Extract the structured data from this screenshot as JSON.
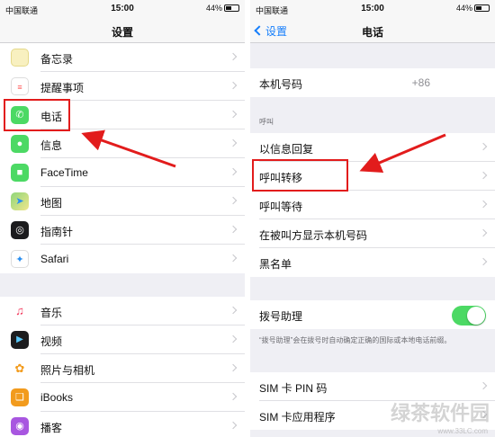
{
  "left": {
    "status": {
      "carrier": "中国联通",
      "time": "15:00",
      "battery": "44%"
    },
    "nav_title": "设置",
    "group1": [
      {
        "label": "备忘录",
        "icon": "notes-icon",
        "color": "#f8f0c0"
      },
      {
        "label": "提醒事项",
        "icon": "reminders-icon",
        "color": "#ffffff"
      },
      {
        "label": "电话",
        "icon": "phone-icon",
        "color": "#4cd964"
      },
      {
        "label": "信息",
        "icon": "messages-icon",
        "color": "#4cd964"
      },
      {
        "label": "FaceTime",
        "icon": "facetime-icon",
        "color": "#4cd964"
      },
      {
        "label": "地图",
        "icon": "maps-icon",
        "color": "#7ac36a"
      },
      {
        "label": "指南针",
        "icon": "compass-icon",
        "color": "#1c1c1e"
      },
      {
        "label": "Safari",
        "icon": "safari-icon",
        "color": "#2a8ef0"
      }
    ],
    "group2": [
      {
        "label": "音乐",
        "icon": "music-icon",
        "color": "#ffffff"
      },
      {
        "label": "视频",
        "icon": "videos-icon",
        "color": "#1c1c1e"
      },
      {
        "label": "照片与相机",
        "icon": "photos-icon",
        "color": "#ffffff"
      },
      {
        "label": "iBooks",
        "icon": "ibooks-icon",
        "color": "#f29b1d"
      },
      {
        "label": "播客",
        "icon": "podcasts-icon",
        "color": "#a856e0"
      }
    ]
  },
  "right": {
    "status": {
      "carrier": "中国联通",
      "time": "15:00",
      "battery": "44%"
    },
    "nav_back": "设置",
    "nav_title": "电话",
    "my_number_label": "本机号码",
    "my_number_value": "+86",
    "section_header": "呼叫",
    "call_rows": [
      "以信息回复",
      "呼叫转移",
      "呼叫等待",
      "在被叫方显示本机号码",
      "黑名单"
    ],
    "dial_assist_label": "拨号助理",
    "dial_assist_note": "“拨号助理”会在拨号时自动确定正确的国际或本地电话前缀。",
    "sim_rows": [
      "SIM 卡 PIN 码",
      "SIM 卡应用程序"
    ]
  },
  "watermark": {
    "text": "绿茶软件园",
    "url": "www.33LC.com"
  },
  "accent_color": "#e21c1c",
  "link_color": "#157efb",
  "toggle_on": true
}
